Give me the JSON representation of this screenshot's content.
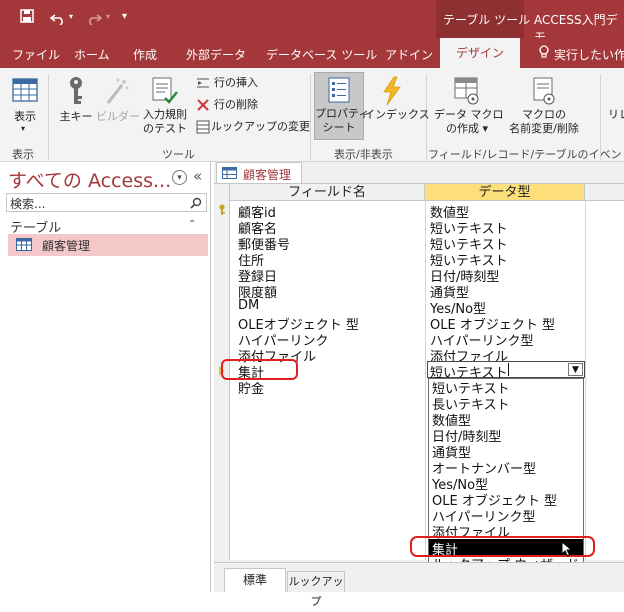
{
  "title_bar": {
    "context_tab": "テーブル ツール",
    "window_title": "ACCESS入門デモ"
  },
  "ribbon_tabs": [
    "ファイル",
    "ホーム",
    "作成",
    "外部データ",
    "データベース ツール",
    "アドイン",
    "デザイン"
  ],
  "tell_me": "実行したい作業",
  "ribbon": {
    "view": "表示",
    "primary_key": "主キー",
    "builder": "ビルダー",
    "test_rules_1": "入力規則",
    "test_rules_2": "のテスト",
    "insert_rows": "行の挿入",
    "delete_rows": "行の削除",
    "modify_lookups": "ルックアップの変更",
    "property_sheet_1": "プロパティ",
    "property_sheet_2": "シート",
    "indexes": "インデックス",
    "data_macros_1": "データ マクロ",
    "data_macros_2": "の作成 ▾",
    "rename_macro_1": "マクロの",
    "rename_macro_2": "名前変更/削除",
    "relationships": "リレ",
    "group_views": "表示",
    "group_tools": "ツール",
    "group_show_hide": "表示/非表示",
    "group_events": "フィールド/レコード/テーブルのイベント"
  },
  "nav": {
    "title": "すべての Access...",
    "search_placeholder": "検索...",
    "section": "テーブル",
    "item": "顧客管理"
  },
  "doc_tab": "顧客管理",
  "grid_headers": {
    "field_name": "フィールド名",
    "data_type": "データ型"
  },
  "fields": [
    {
      "name": "顧客id",
      "type": "数値型"
    },
    {
      "name": "顧客名",
      "type": "短いテキスト"
    },
    {
      "name": "郵便番号",
      "type": "短いテキスト"
    },
    {
      "name": "住所",
      "type": "短いテキスト"
    },
    {
      "name": "登録日",
      "type": "日付/時刻型"
    },
    {
      "name": "限度額",
      "type": "通貨型"
    },
    {
      "name": "DM",
      "type": "Yes/No型"
    },
    {
      "name": "OLEオブジェクト 型",
      "type": "OLE オブジェクト 型"
    },
    {
      "name": "ハイパーリンク",
      "type": "ハイパーリンク型"
    },
    {
      "name": "添付ファイル",
      "type": "添付ファイル"
    },
    {
      "name": "集計",
      "type": "短いテキスト"
    },
    {
      "name": "貯金",
      "type": ""
    }
  ],
  "dropdown_options": [
    "短いテキスト",
    "長いテキスト",
    "数値型",
    "日付/時刻型",
    "通貨型",
    "オートナンバー型",
    "Yes/No型",
    "OLE オブジェクト 型",
    "ハイパーリンク型",
    "添付ファイル",
    "集計",
    "ルックアップ ウィザード..."
  ],
  "highlighted_option": "集計",
  "bottom_tabs": [
    "標準",
    "ルックアップ"
  ],
  "colors": {
    "brand": "#a4373a",
    "annotation": "#e02020",
    "selected": "#000000",
    "nav_highlight": "#f4c7c9"
  }
}
